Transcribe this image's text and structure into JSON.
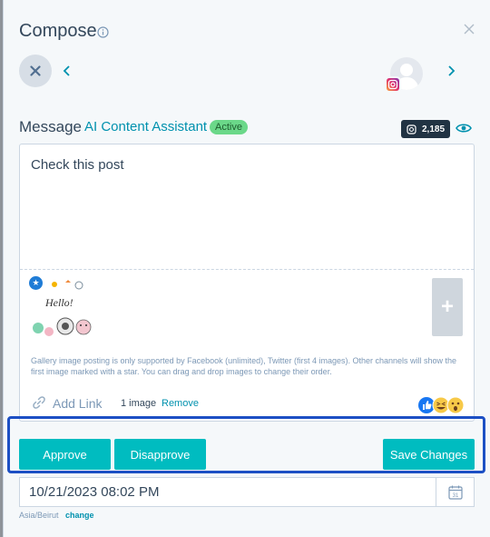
{
  "header": {
    "title": "Compose",
    "info_icon": "info-circle-icon",
    "close_icon": "close-icon"
  },
  "profile_row": {
    "cancel_icon": "x-icon",
    "prev_icon": "chevron-left-icon",
    "next_icon": "chevron-right-icon",
    "avatar_network": "instagram"
  },
  "message": {
    "label": "Message",
    "ai_assistant": "AI Content Assistant",
    "status_badge": "Active",
    "char_count": "2,185",
    "preview_icon": "eye-icon"
  },
  "editor": {
    "text": "Check this post",
    "image_caption": "Hello!",
    "add_media_label": "+",
    "gallery_note": "Gallery image posting is only supported by Facebook (unlimited), Twitter (first 4 images). Other channels will show the first image marked with a star. You can drag and drop images to change their order.",
    "add_link": "Add Link",
    "image_count": "1 image",
    "remove": "Remove"
  },
  "actions": {
    "approve": "Approve",
    "disapprove": "Disapprove",
    "save": "Save Changes"
  },
  "schedule": {
    "datetime": "10/21/2023 08:02 PM",
    "calendar_day": "31",
    "timezone": "Asia/Beirut",
    "change": "change"
  },
  "colors": {
    "accent": "#00bcc0",
    "link": "#0091ae",
    "highlight": "#1c4fc4",
    "active_badge": "#6bd889"
  }
}
